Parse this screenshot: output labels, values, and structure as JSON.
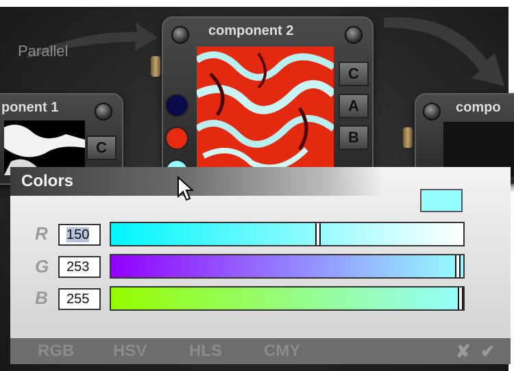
{
  "canvas": {
    "parallel_label": "Parallel"
  },
  "nodes": {
    "component1": {
      "title": "ponent 1",
      "ports": [
        "C"
      ]
    },
    "component2": {
      "title": "component 2",
      "ports": [
        "C",
        "A",
        "B"
      ],
      "dot_colors": [
        "#0a0a4a",
        "#e82a10",
        "#96fdff"
      ]
    },
    "component3": {
      "title": "compo"
    }
  },
  "colors_dialog": {
    "title": "Colors",
    "swatch_color": "#96fdff",
    "channels": [
      {
        "label": "R",
        "value": "150",
        "level": 0.588
      },
      {
        "label": "G",
        "value": "253",
        "level": 0.992
      },
      {
        "label": "B",
        "value": "255",
        "level": 1.0
      }
    ],
    "modes": [
      "RGB",
      "HSV",
      "HLS",
      "CMY"
    ],
    "cancel_icon": "✘",
    "ok_icon": "✔"
  }
}
